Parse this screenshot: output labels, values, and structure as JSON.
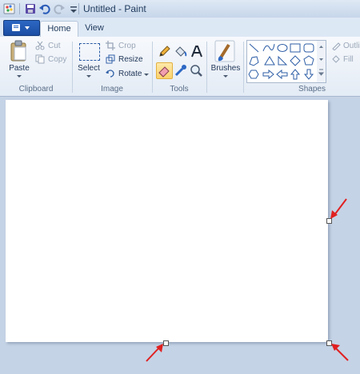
{
  "window": {
    "title": "Untitled - Paint"
  },
  "tabs": [
    {
      "label": "Home",
      "active": true
    },
    {
      "label": "View",
      "active": false
    }
  ],
  "groups": {
    "clipboard": {
      "label": "Clipboard",
      "paste": "Paste",
      "cut": "Cut",
      "copy": "Copy"
    },
    "image": {
      "label": "Image",
      "select": "Select",
      "crop": "Crop",
      "resize": "Resize",
      "rotate": "Rotate"
    },
    "tools": {
      "label": "Tools"
    },
    "brushes": {
      "label": "Brushes"
    },
    "shapes": {
      "label": "Shapes",
      "outline": "Outli",
      "fill": "Fill"
    }
  },
  "colors": {
    "arrow": "#e02020",
    "accent": "#2d68c4"
  },
  "shapes_gallery": [
    "line",
    "curve",
    "oval",
    "rectangle",
    "rounded-rectangle",
    "polygon",
    "triangle",
    "right-triangle",
    "diamond",
    "pentagon",
    "hexagon",
    "arrow-right",
    "arrow-left",
    "arrow-up",
    "arrow-down"
  ]
}
